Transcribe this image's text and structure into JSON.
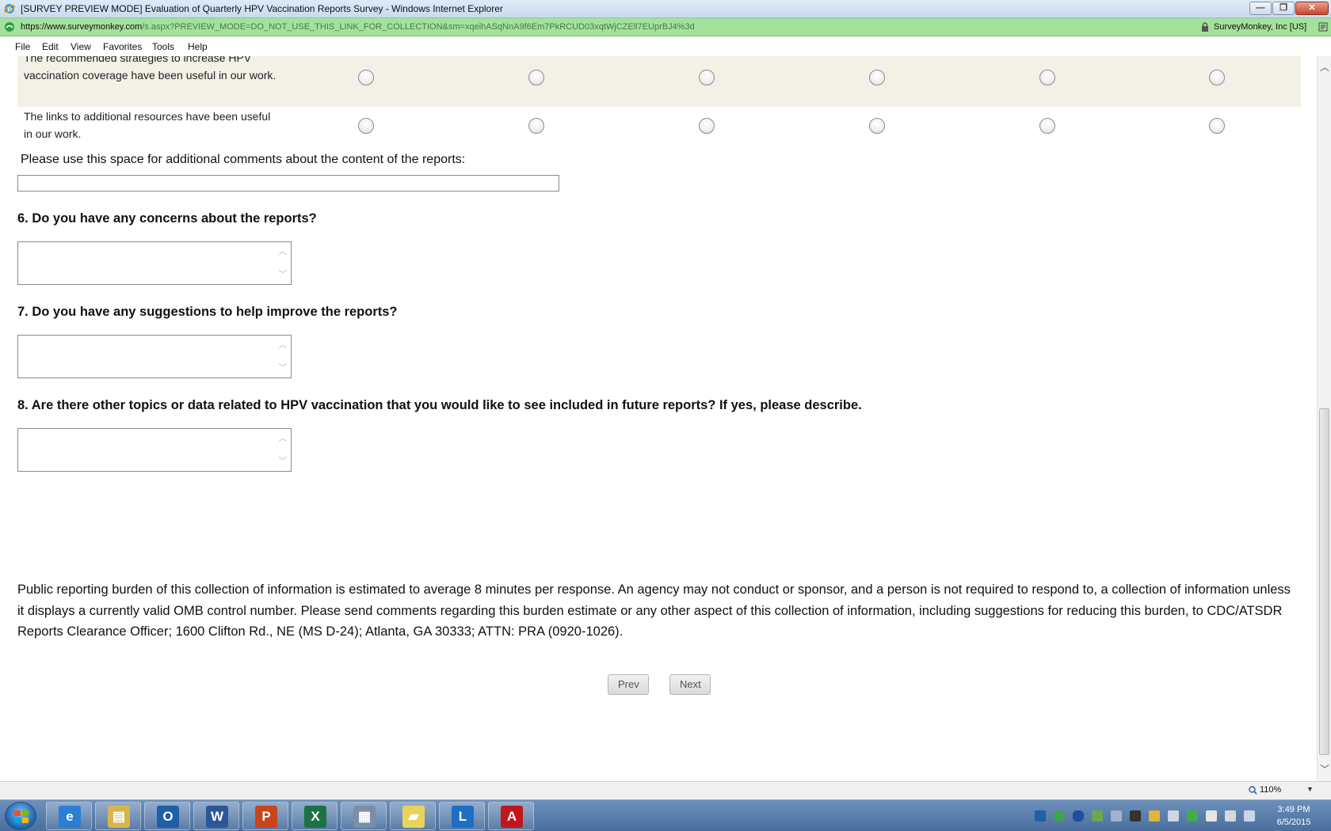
{
  "window": {
    "title": "[SURVEY PREVIEW MODE] Evaluation of Quarterly HPV Vaccination Reports Survey - Windows Internet Explorer",
    "minimize": "—",
    "restore": "❐",
    "close": "✕"
  },
  "address": {
    "scheme": "https://www.",
    "host": "surveymonkey.com",
    "path": "/s.aspx?PREVIEW_MODE=DO_NOT_USE_THIS_LINK_FOR_COLLECTION&sm=xqeihASqNnA9f6Em7PkRCUD03xqtWjCZEll7EUprBJ4%3d",
    "certificate": "SurveyMonkey, Inc [US]"
  },
  "menu": [
    "File",
    "Edit",
    "View",
    "Favorites",
    "Tools",
    "Help"
  ],
  "matrix": {
    "rows": [
      {
        "label": "The recommended strategies to increase HPV vaccination coverage have been useful in our work.",
        "shaded": true
      },
      {
        "label": "The links to additional resources have been useful in our work.",
        "shaded": false
      }
    ],
    "column_count": 6
  },
  "comment": {
    "label": "Please use this space for additional comments about the content of the reports:",
    "value": ""
  },
  "questions": [
    {
      "title": "6. Do you have any concerns about the reports?",
      "value": ""
    },
    {
      "title": "7. Do you have any suggestions to help improve the reports?",
      "value": ""
    },
    {
      "title": "8. Are there other topics or data related to HPV vaccination that you would like to see included in future reports? If yes, please describe.",
      "value": ""
    }
  ],
  "burden_text": "Public reporting burden of this collection of information is estimated to average 8 minutes per response. An agency may not conduct or sponsor, and a person is not required to respond to, a collection of information unless it displays a currently valid OMB control number. Please send comments regarding this burden estimate or any other aspect of this collection of information, including suggestions for reducing this burden, to CDC/ATSDR Reports Clearance Officer; 1600 Clifton Rd., NE (MS D-24); Atlanta, GA 30333; ATTN: PRA (0920-1026).",
  "nav": {
    "prev": "Prev",
    "next": "Next"
  },
  "status": {
    "zoom": "110%"
  },
  "taskbar": {
    "apps": [
      {
        "name": "internet-explorer",
        "icon": "e",
        "color": "#2a7fd4"
      },
      {
        "name": "file-explorer",
        "icon": "▤",
        "color": "#d9b44a"
      },
      {
        "name": "outlook",
        "icon": "O",
        "color": "#1f5fa8"
      },
      {
        "name": "word",
        "icon": "W",
        "color": "#2b5797"
      },
      {
        "name": "powerpoint",
        "icon": "P",
        "color": "#c8451c"
      },
      {
        "name": "excel",
        "icon": "X",
        "color": "#1e7145"
      },
      {
        "name": "calculator",
        "icon": "▦",
        "color": "#7a8ea8"
      },
      {
        "name": "sticky-notes",
        "icon": "▰",
        "color": "#e8d45a"
      },
      {
        "name": "lync",
        "icon": "L",
        "color": "#1c6fc4"
      },
      {
        "name": "acrobat",
        "icon": "A",
        "color": "#c0161c"
      }
    ],
    "time": "3:49 PM",
    "date": "6/5/2015"
  },
  "colors": {
    "address_bar": "#a3e29a",
    "matrix_shade": "#f3f0e6",
    "taskbar": "#5a7fae"
  }
}
